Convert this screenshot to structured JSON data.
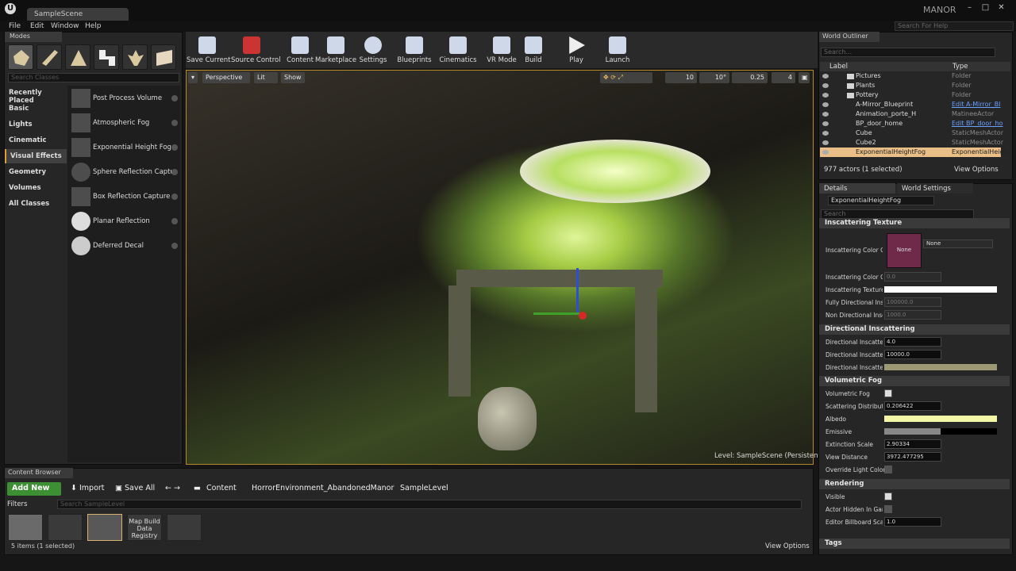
{
  "app": {
    "logo": "U",
    "tab": "SampleScene",
    "project": "MANOR",
    "help_placeholder": "Search For Help",
    "win_min": "–",
    "win_max": "□",
    "win_close": "✕"
  },
  "menu": [
    "File",
    "Edit",
    "Window",
    "Help"
  ],
  "modes": {
    "tab": "Modes",
    "search_placeholder": "Search Classes",
    "categories": [
      "Recently Placed",
      "Basic",
      "Lights",
      "Cinematic",
      "Visual Effects",
      "Geometry",
      "Volumes",
      "All Classes"
    ],
    "active_category": "Visual Effects",
    "items": [
      "Post Process Volume",
      "Atmospheric Fog",
      "Exponential Height Fog",
      "Sphere Reflection Captu",
      "Box Reflection Capture",
      "Planar Reflection",
      "Deferred Decal"
    ]
  },
  "toolbar": [
    "Save Current",
    "Source Control",
    "Content",
    "Marketplace",
    "Settings",
    "Blueprints",
    "Cinematics",
    "VR Mode",
    "Build",
    "Play",
    "Launch"
  ],
  "viewport": {
    "perspective": "Perspective",
    "lit": "Lit",
    "show": "Show",
    "grid": "10",
    "rot": "10°",
    "scale": "0.25",
    "cam": "4",
    "level_label": "Level:",
    "level": "SampleScene (Persistent)"
  },
  "outliner": {
    "tab": "World Outliner",
    "search": "Search...",
    "col_label": "Label",
    "col_type": "Type",
    "rows": [
      {
        "name": "Pictures",
        "type": "Folder"
      },
      {
        "name": "Plants",
        "type": "Folder"
      },
      {
        "name": "Pottery",
        "type": "Folder"
      },
      {
        "name": "A-Mirror_Blueprint",
        "type": "Edit A-Mirror_Bl"
      },
      {
        "name": "Animation_porte_H",
        "type": "MatineeActor"
      },
      {
        "name": "BP_door_home",
        "type": "Edit BP_door_ho"
      },
      {
        "name": "Cube",
        "type": "StaticMeshActor"
      },
      {
        "name": "Cube2",
        "type": "StaticMeshActor"
      },
      {
        "name": "ExponentialHeightFog",
        "type": "ExponentialHeigh"
      }
    ],
    "footer": "977 actors (1 selected)",
    "view_options": "View Options"
  },
  "details": {
    "tab_details": "Details",
    "tab_world": "World Settings",
    "actor": "ExponentialHeightFog",
    "search": "Search",
    "sec_inscattering": "Inscattering Texture",
    "inscat_color": "Inscattering Color Cu",
    "swatch": "None",
    "tex_select": "None",
    "inscat_color2": "Inscattering Color Cu",
    "inscat_color2_val": "0.0",
    "inscat_texture": "Inscattering Texture",
    "fully_dir": "Fully Directional Insc",
    "fully_dir_val": "100000.0",
    "non_dir": "Non Directional Insc",
    "non_dir_val": "1000.0",
    "sec_directional": "Directional Inscattering",
    "dir1": "Directional Inscatteri",
    "dir1_val": "4.0",
    "dir2": "Directional Inscatteri",
    "dir2_val": "10000.0",
    "dir3": "Directional Inscatteri",
    "sec_volumetric": "Volumetric Fog",
    "vol_fog": "Volumetric Fog",
    "scatter": "Scattering Distributi",
    "scatter_val": "0.206422",
    "albedo": "Albedo",
    "emissive": "Emissive",
    "extinction": "Extinction Scale",
    "extinction_val": "2.90334",
    "view_dist": "View Distance",
    "view_dist_val": "3972.477295",
    "override": "Override Light Colors",
    "sec_rendering": "Rendering",
    "visible": "Visible",
    "hidden_game": "Actor Hidden In Gam",
    "billboard": "Editor Billboard Scal",
    "billboard_val": "1.0",
    "sec_tags": "Tags"
  },
  "content_browser": {
    "tab": "Content Browser",
    "add_new": "Add New",
    "import": "Import",
    "save_all": "Save All",
    "crumbs": [
      "Content",
      "HorrorEnvironment_AbandonedManor",
      "SampleLevel"
    ],
    "filters": "Filters",
    "search": "Search SampleLevel",
    "asset_label": "Map Build Data Registry",
    "items": "5 items (1 selected)",
    "view_options": "View Options"
  },
  "colors": {
    "accent": "#e0a030",
    "selection": "#e9be87",
    "add_new": "#3c8f33",
    "fog_green": "#a7cd46"
  }
}
